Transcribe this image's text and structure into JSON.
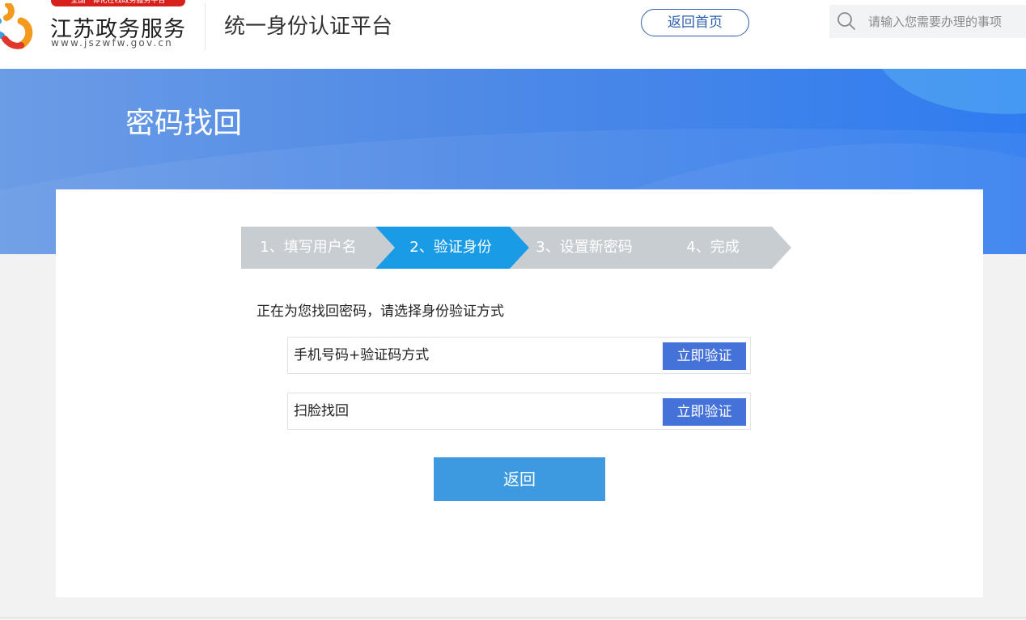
{
  "header": {
    "logo_banner": "全国一体化在线政务服务平台",
    "logo_name": "江苏政务服务",
    "logo_url": "www.jszwfw.gov.cn",
    "platform_title": "统一身份认证平台",
    "home_button": "返回首页",
    "search": {
      "placeholder": "请输入您需要办理的事项",
      "value": ""
    }
  },
  "banner": {
    "title": "密码找回"
  },
  "steps": [
    {
      "label": "1、填写用户名",
      "state": "done"
    },
    {
      "label": "2、验证身份",
      "state": "active"
    },
    {
      "label": "3、设置新密码",
      "state": "pending"
    },
    {
      "label": "4、完成",
      "state": "pending"
    }
  ],
  "prompt": "正在为您找回密码，请选择身份验证方式",
  "methods": [
    {
      "label": "手机号码+验证码方式",
      "button": "立即验证"
    },
    {
      "label": "扫脸找回",
      "button": "立即验证"
    }
  ],
  "back_button": "返回",
  "colors": {
    "step_active": "#1a9be6",
    "step_inactive": "#c8cdd2",
    "verify_button": "#4472d9",
    "back_button": "#3d9ae0",
    "home_button_border": "#2d5fa8",
    "logo_red": "#d7201c"
  }
}
